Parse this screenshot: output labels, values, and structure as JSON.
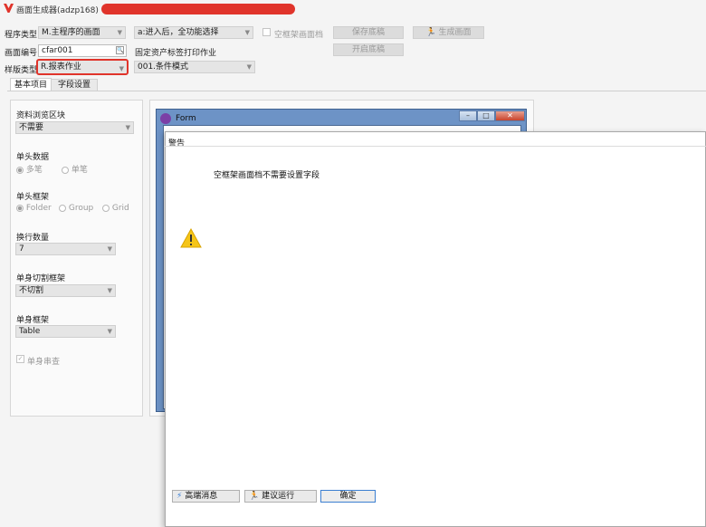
{
  "window": {
    "title": "画面生成器(adzp168)"
  },
  "toolbar": {
    "program_type_label": "程序类型",
    "program_type_value": "M.主程序的画面",
    "action_value": "a:进入后，全功能选择",
    "empty_frame_label": "空框架画面档",
    "save_draft_button": "保存底稿",
    "generate_button": "生成画面",
    "screen_no_label": "画面编号",
    "screen_no_value": "cfar001",
    "fixed_assets_label": "固定资产标签打印作业",
    "open_draft_button": "开启底稿",
    "template_label": "样版类型",
    "template_value": "R.报表作业",
    "mode_value": "001.条件模式"
  },
  "tabs": [
    "基本项目",
    "字段设置"
  ],
  "left_panel": {
    "browse_label": "资料浏览区块",
    "browse_value": "不需要",
    "single_header_label": "单头数据",
    "single_header_options": [
      "多笔",
      "单笔"
    ],
    "header_frame_label": "单头框架",
    "header_frame_options": [
      "Folder",
      "Group",
      "Grid"
    ],
    "rows_label": "换行数量",
    "rows_value": "7",
    "body_split_label": "单身切割框架",
    "body_split_value": "不切割",
    "body_frame_label": "单身框架",
    "body_frame_value": "Table",
    "body_query_label": "单身串查"
  },
  "form_window": {
    "title": "Form"
  },
  "dialog": {
    "header": "警告",
    "message": "空框架画面档不需要设置字段",
    "btn_advanced": "高端消息",
    "btn_suggest": "建议运行",
    "btn_ok": "确定"
  },
  "colors": {
    "accent": "#e0342b",
    "warning": "#f5c518"
  }
}
